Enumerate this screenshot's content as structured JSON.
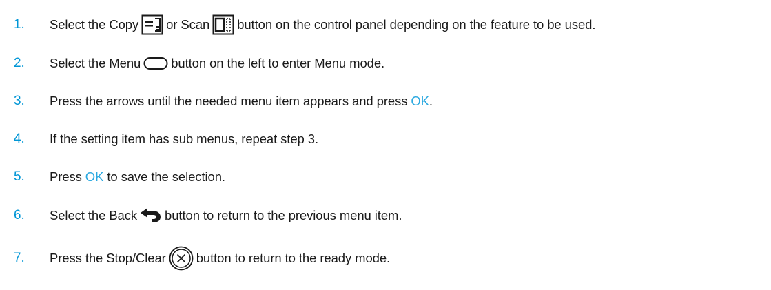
{
  "steps": [
    {
      "number": "1.",
      "parts": {
        "a": "Select the Copy",
        "icon1": "copy-icon",
        "b": "or Scan",
        "icon2": "scan-icon",
        "c": "button on the control panel depending on the feature to be used."
      }
    },
    {
      "number": "2.",
      "parts": {
        "a": "Select the Menu",
        "icon1": "menu-button-icon",
        "b": "button on the left to enter Menu mode."
      }
    },
    {
      "number": "3.",
      "parts": {
        "a": "Press the arrows until the needed menu item appears and press",
        "ok": "OK",
        "b": "."
      }
    },
    {
      "number": "4.",
      "parts": {
        "a": "If the setting item has sub menus, repeat step 3."
      }
    },
    {
      "number": "5.",
      "parts": {
        "a": "Press",
        "ok": "OK",
        "b": "to save the selection."
      }
    },
    {
      "number": "6.",
      "parts": {
        "a": "Select the Back",
        "icon1": "back-arrow-icon",
        "b": "button to return to the previous menu item."
      }
    },
    {
      "number": "7.",
      "parts": {
        "a": "Press the Stop/Clear",
        "icon1": "stop-clear-icon",
        "b": "button to return to the ready mode."
      }
    }
  ],
  "colors": {
    "number": "#0096d6",
    "accent": "#29a8e0",
    "text": "#1a1a1a"
  }
}
